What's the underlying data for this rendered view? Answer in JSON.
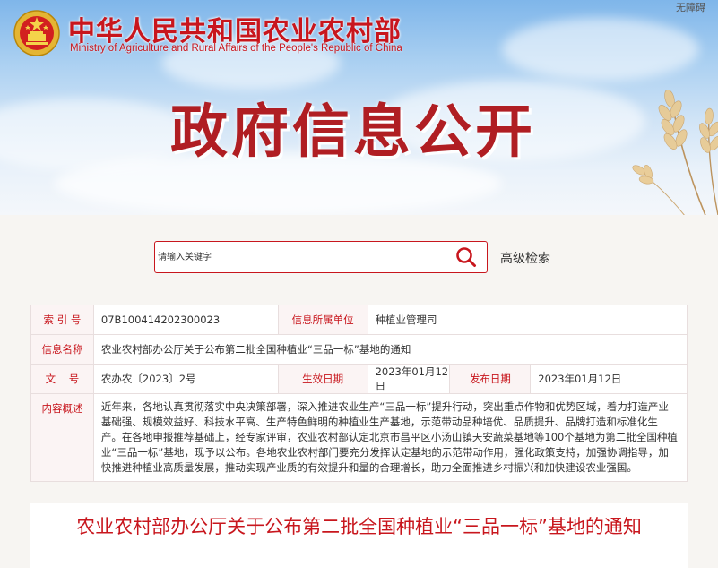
{
  "header": {
    "ministry_cn": "中华人民共和国农业农村部",
    "ministry_en": "Ministry of Agriculture and Rural Affairs of the People's Republic of China",
    "accessibility_link": "无障碍",
    "page_heading": "政府信息公开",
    "emblem_icon": "national-emblem-icon"
  },
  "search": {
    "placeholder": "请输入关键字",
    "button_icon": "search-icon",
    "advanced_label": "高级检索"
  },
  "info": {
    "index_label": "索 引 号",
    "index_value": "07B100414202300023",
    "office_label": "信息所属单位",
    "office_value": "种植业管理司",
    "name_label": "信息名称",
    "name_value": "农业农村部办公厅关于公布第二批全国种植业“三品一标”基地的通知",
    "doc_label": "文    号",
    "doc_value": "农办农〔2023〕2号",
    "effective_label": "生效日期",
    "effective_value": "2023年01月12日",
    "publish_label": "发布日期",
    "publish_value": "2023年01月12日",
    "summary_label": "内容概述",
    "summary_value": "近年来，各地认真贯彻落实中央决策部署，深入推进农业生产“三品一标”提升行动，突出重点作物和优势区域，着力打造产业基础强、规模效益好、科技水平高、生产特色鲜明的种植业生产基地，示范带动品种培优、品质提升、品牌打造和标准化生产。在各地申报推荐基础上，经专家评审，农业农村部认定北京市昌平区小汤山镇天安蔬菜基地等100个基地为第二批全国种植业“三品一标”基地，现予以公布。各地农业农村部门要充分发挥认定基地的示范带动作用，强化政策支持，加强协调指导，加快推进种植业高质量发展，推动实现产业质的有效提升和量的合理增长，助力全面推进乡村振兴和加快建设农业强国。"
  },
  "article": {
    "title": "农业农村部办公厅关于公布第二批全国种植业“三品一标”基地的通知"
  },
  "colors": {
    "brand_red": "#c8161d",
    "label_red": "#c8161d",
    "heading_red": "#b01e23",
    "sky_blue": "#7fb6ea",
    "page_bg": "#f7f5f2"
  }
}
